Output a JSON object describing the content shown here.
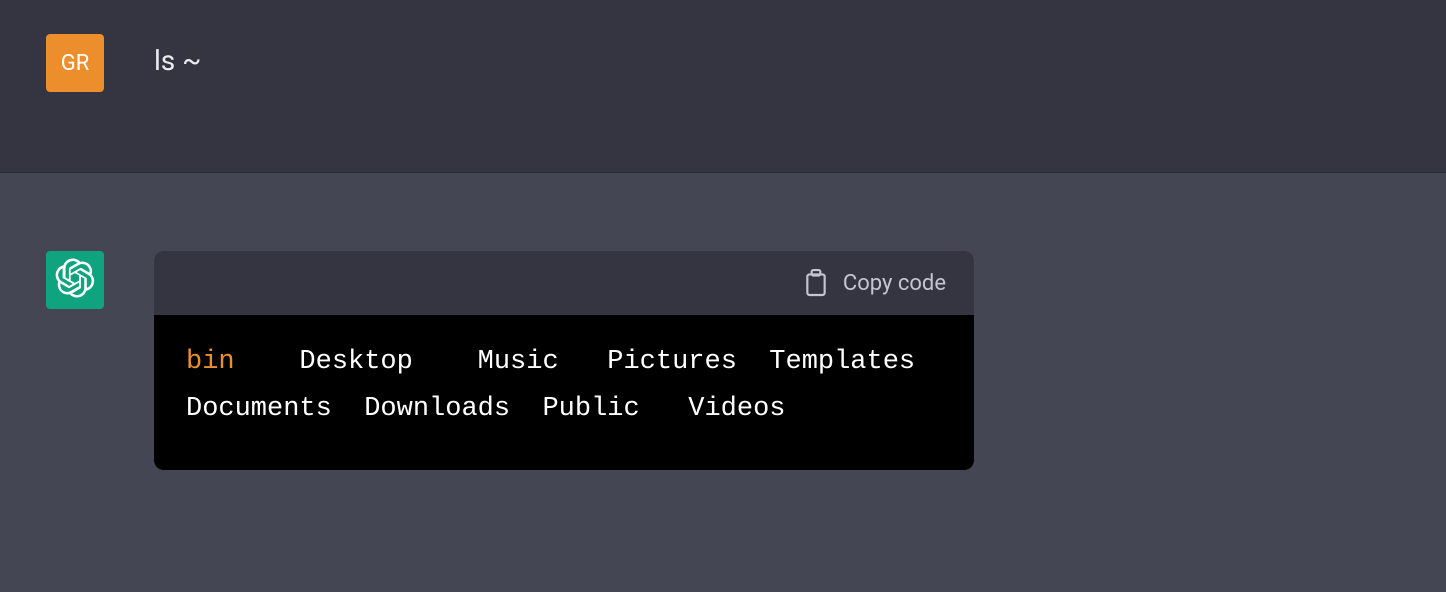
{
  "user": {
    "avatar_initials": "GR",
    "message": "ls ~"
  },
  "assistant": {
    "copy_label": "Copy code",
    "code": {
      "highlighted": "bin",
      "row1_rest": "    Desktop    Music   Pictures  Templates",
      "row2": "Documents  Downloads  Public   Videos"
    }
  }
}
